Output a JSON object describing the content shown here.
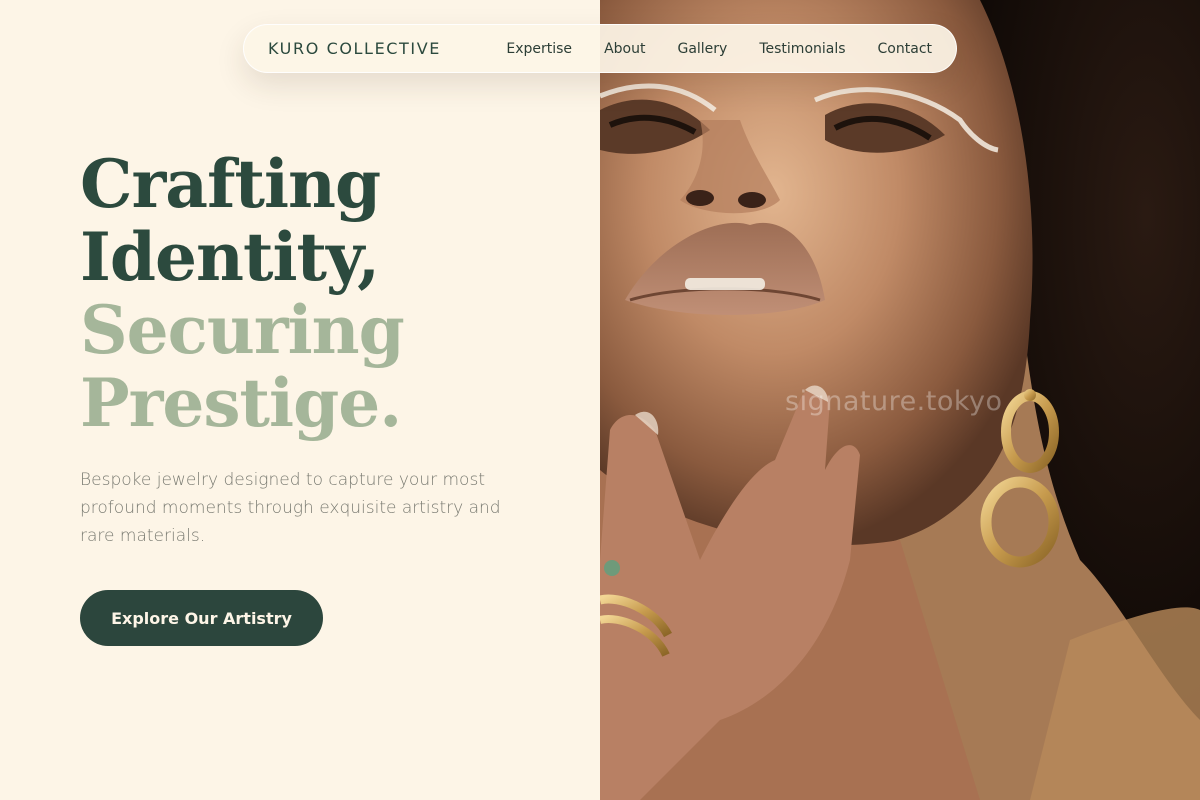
{
  "brand": "KURO COLLECTIVE",
  "nav": {
    "links": [
      "Expertise",
      "About",
      "Gallery",
      "Testimonials",
      "Contact"
    ]
  },
  "hero": {
    "headline_dark": [
      "Crafting",
      "Identity,"
    ],
    "headline_light": [
      "Securing",
      "Prestige."
    ],
    "description": "Bespoke jewelry designed to capture your most profound moments through exquisite artistry and rare materials.",
    "cta_label": "Explore Our Artistry"
  },
  "image": {
    "subject": "hero-portrait",
    "watermark": "signature.tokyo"
  },
  "colors": {
    "background": "#fdf5e7",
    "primary_dark_green": "#2c4a3e",
    "accent_sage": "#a5b69a",
    "body_text": "#7a7b72",
    "button_bg": "#2c463d"
  }
}
